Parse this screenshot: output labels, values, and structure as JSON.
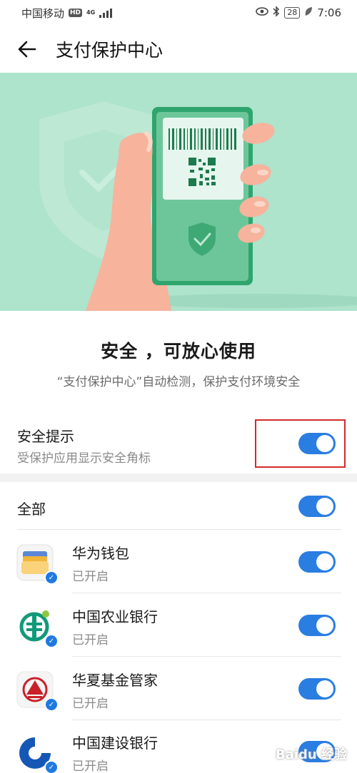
{
  "status_bar": {
    "carrier": "中国移动",
    "hd": "HD",
    "network": "4G",
    "battery": "28",
    "time": "7:06"
  },
  "header": {
    "title": "支付保护中心"
  },
  "summary": {
    "title": "安全 ，可放心使用",
    "subtitle": "“支付保护中心”自动检测，保护支付环境安全"
  },
  "security_tip": {
    "title": "安全提示",
    "subtitle": "受保护应用显示安全角标",
    "enabled": true
  },
  "apps_header": {
    "label": "全部",
    "enabled": true
  },
  "apps": [
    {
      "name": "华为钱包",
      "status": "已开启",
      "icon": "wallet-icon",
      "enabled": true
    },
    {
      "name": "中国农业银行",
      "status": "已开启",
      "icon": "abc-bank-icon",
      "enabled": true
    },
    {
      "name": "华夏基金管家",
      "status": "已开启",
      "icon": "huaxia-fund-icon",
      "enabled": true
    },
    {
      "name": "中国建设银行",
      "status": "已开启",
      "icon": "ccb-bank-icon",
      "enabled": true
    }
  ],
  "watermark": "Baidu 经验",
  "colors": {
    "accent": "#2a7de1",
    "hero_bg": "#aee3cc",
    "highlight": "#d32a2a"
  }
}
